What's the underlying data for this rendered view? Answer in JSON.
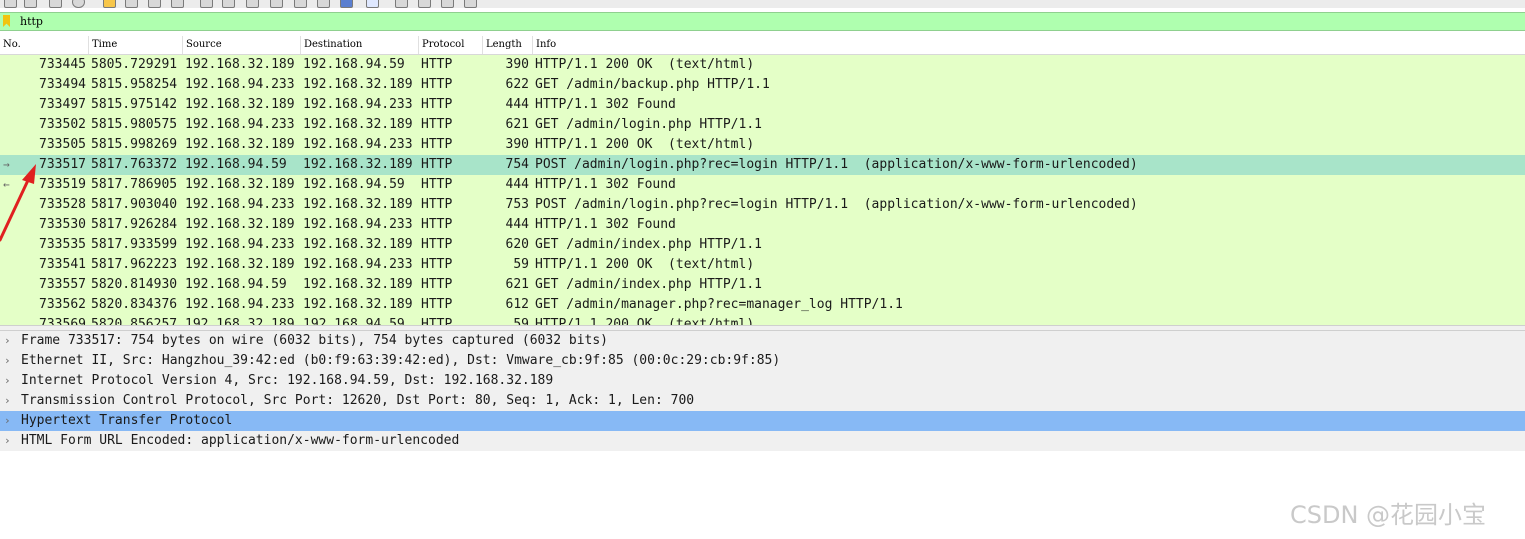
{
  "filter": {
    "value": "http"
  },
  "columns": [
    "No.",
    "Time",
    "Source",
    "Destination",
    "Protocol",
    "Length",
    "Info"
  ],
  "packets": [
    {
      "no": "733445",
      "time": "5805.729291",
      "src": "192.168.32.189",
      "dst": "192.168.94.59",
      "proto": "HTTP",
      "len": "390",
      "info": "HTTP/1.1 200 OK  (text/html)"
    },
    {
      "no": "733494",
      "time": "5815.958254",
      "src": "192.168.94.233",
      "dst": "192.168.32.189",
      "proto": "HTTP",
      "len": "622",
      "info": "GET /admin/backup.php HTTP/1.1"
    },
    {
      "no": "733497",
      "time": "5815.975142",
      "src": "192.168.32.189",
      "dst": "192.168.94.233",
      "proto": "HTTP",
      "len": "444",
      "info": "HTTP/1.1 302 Found"
    },
    {
      "no": "733502",
      "time": "5815.980575",
      "src": "192.168.94.233",
      "dst": "192.168.32.189",
      "proto": "HTTP",
      "len": "621",
      "info": "GET /admin/login.php HTTP/1.1"
    },
    {
      "no": "733505",
      "time": "5815.998269",
      "src": "192.168.32.189",
      "dst": "192.168.94.233",
      "proto": "HTTP",
      "len": "390",
      "info": "HTTP/1.1 200 OK  (text/html)"
    },
    {
      "no": "733517",
      "time": "5817.763372",
      "src": "192.168.94.59",
      "dst": "192.168.32.189",
      "proto": "HTTP",
      "len": "754",
      "info": "POST /admin/login.php?rec=login HTTP/1.1  (application/x-www-form-urlencoded)"
    },
    {
      "no": "733519",
      "time": "5817.786905",
      "src": "192.168.32.189",
      "dst": "192.168.94.59",
      "proto": "HTTP",
      "len": "444",
      "info": "HTTP/1.1 302 Found"
    },
    {
      "no": "733528",
      "time": "5817.903040",
      "src": "192.168.94.233",
      "dst": "192.168.32.189",
      "proto": "HTTP",
      "len": "753",
      "info": "POST /admin/login.php?rec=login HTTP/1.1  (application/x-www-form-urlencoded)"
    },
    {
      "no": "733530",
      "time": "5817.926284",
      "src": "192.168.32.189",
      "dst": "192.168.94.233",
      "proto": "HTTP",
      "len": "444",
      "info": "HTTP/1.1 302 Found"
    },
    {
      "no": "733535",
      "time": "5817.933599",
      "src": "192.168.94.233",
      "dst": "192.168.32.189",
      "proto": "HTTP",
      "len": "620",
      "info": "GET /admin/index.php HTTP/1.1"
    },
    {
      "no": "733541",
      "time": "5817.962223",
      "src": "192.168.32.189",
      "dst": "192.168.94.233",
      "proto": "HTTP",
      "len": "59",
      "info": "HTTP/1.1 200 OK  (text/html)"
    },
    {
      "no": "733557",
      "time": "5820.814930",
      "src": "192.168.94.59",
      "dst": "192.168.32.189",
      "proto": "HTTP",
      "len": "621",
      "info": "GET /admin/index.php HTTP/1.1"
    },
    {
      "no": "733562",
      "time": "5820.834376",
      "src": "192.168.94.233",
      "dst": "192.168.32.189",
      "proto": "HTTP",
      "len": "612",
      "info": "GET /admin/manager.php?rec=manager_log HTTP/1.1"
    },
    {
      "no": "733569",
      "time": "5820.856257",
      "src": "192.168.32.189",
      "dst": "192.168.94.59",
      "proto": "HTTP",
      "len": "59",
      "info": "HTTP/1.1 200 OK  (text/html)"
    }
  ],
  "selected_packet_index": 5,
  "details": [
    "Frame 733517: 754 bytes on wire (6032 bits), 754 bytes captured (6032 bits)",
    "Ethernet II, Src: Hangzhou_39:42:ed (b0:f9:63:39:42:ed), Dst: Vmware_cb:9f:85 (00:0c:29:cb:9f:85)",
    "Internet Protocol Version 4, Src: 192.168.94.59, Dst: 192.168.32.189",
    "Transmission Control Protocol, Src Port: 12620, Dst Port: 80, Seq: 1, Ack: 1, Len: 700",
    "Hypertext Transfer Protocol",
    "HTML Form URL Encoded: application/x-www-form-urlencoded"
  ],
  "selected_detail_index": 4,
  "watermark": "CSDN @花园小宝",
  "colors": {
    "filter_bg": "#afffaf",
    "row_bg": "#e4ffc7",
    "row_selected": "#a8e4c9",
    "detail_bg": "#f0f0f0",
    "detail_selected": "#87b9f5",
    "annotation_arrow": "#e02020"
  },
  "icons": [
    "bookmark-icon",
    "chevron-right-icon",
    "red-arrow-annotation"
  ]
}
